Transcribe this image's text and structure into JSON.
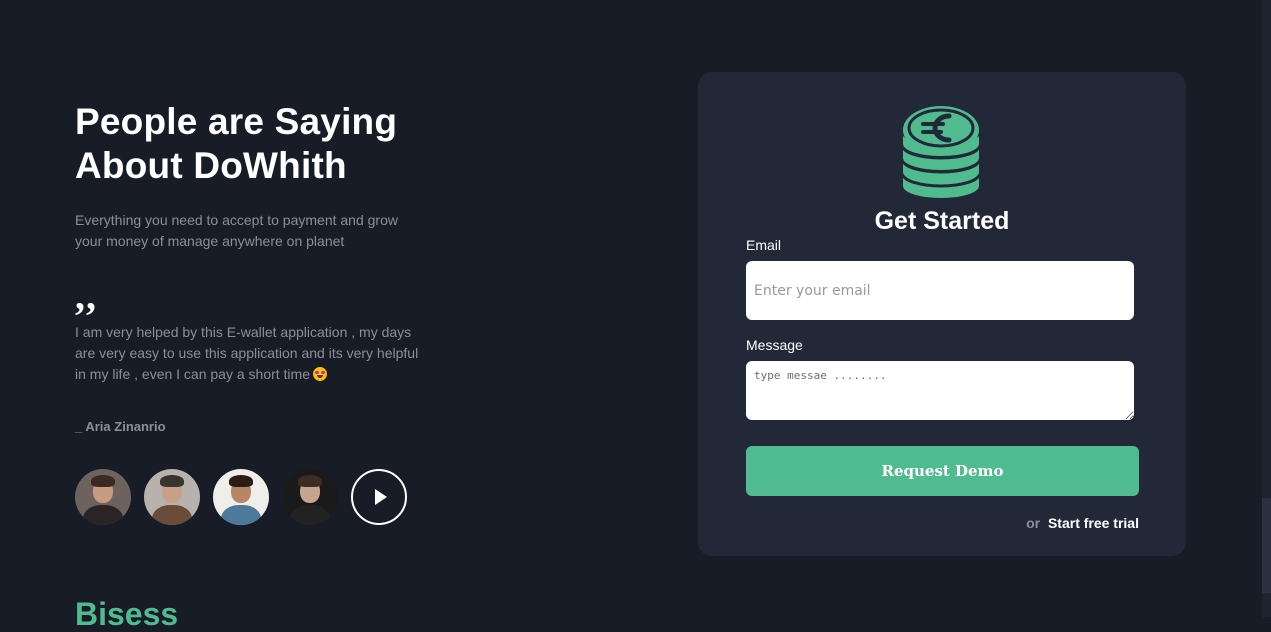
{
  "testimonials": {
    "headline_line1": "People are Saying",
    "headline_line2": "About DoWhith",
    "subtitle": "Everything you need to accept to payment and grow your money of manage anywhere on planet",
    "quote_mark": ",,",
    "quote_text": "I am very helped by this E-wallet application , my days are very easy to use this application and its very helpful in my life , even I can pay a short time",
    "quote_emoji": "star-struck-emoji",
    "author": "_ Aria Zinanrio",
    "avatars": [
      "avatar-man-beard-1",
      "avatar-man-beard-2",
      "avatar-man-smiling",
      "avatar-man-curly-hair"
    ],
    "play_icon": "play-icon"
  },
  "next_section": {
    "title_peek": "Bisess"
  },
  "signup_card": {
    "logo_icon": "euro-coin-stack-icon",
    "title": "Get Started",
    "email_label": "Email",
    "email_placeholder": "Enter your email",
    "email_value": "",
    "message_label": "Message",
    "message_placeholder": "type messae ........",
    "message_value": "",
    "request_button": "Request Demo",
    "or_text": "or",
    "trial_link": "Start free trial"
  },
  "colors": {
    "background": "#181c27",
    "card_background": "#222838",
    "accent": "#4fbb8f",
    "muted_text": "#8b8f9a",
    "text": "#ffffff"
  }
}
